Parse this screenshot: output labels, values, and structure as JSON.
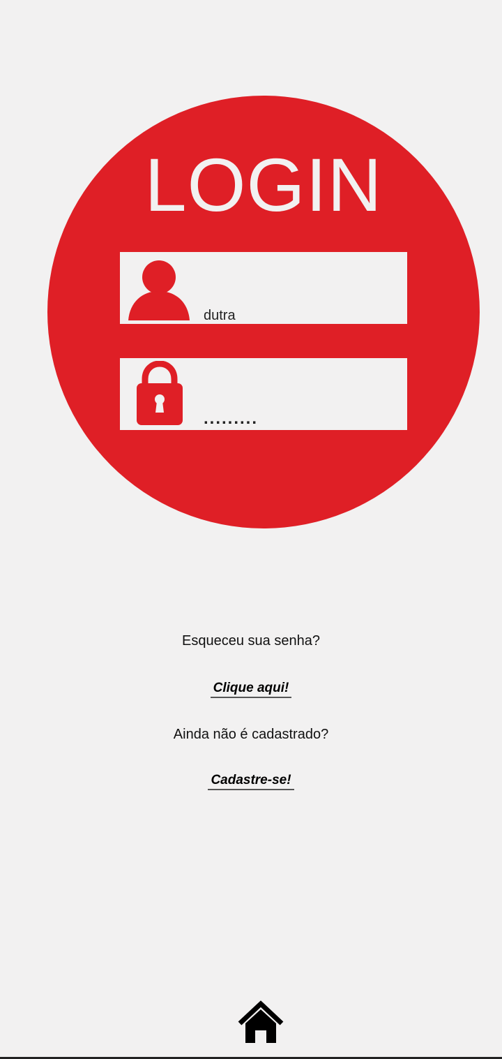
{
  "login": {
    "title": "LOGIN",
    "username_value": "dutra",
    "password_value": "........."
  },
  "links": {
    "forgot_question": "Esqueceu sua senha?",
    "forgot_link": "Clique aqui!",
    "register_question": "Ainda não é cadastrado?",
    "register_link": "Cadastre-se!"
  },
  "icons": {
    "user": "user-icon",
    "lock": "lock-icon",
    "home": "home-icon"
  },
  "colors": {
    "accent": "#df1f26",
    "background": "#f2f1f1"
  }
}
